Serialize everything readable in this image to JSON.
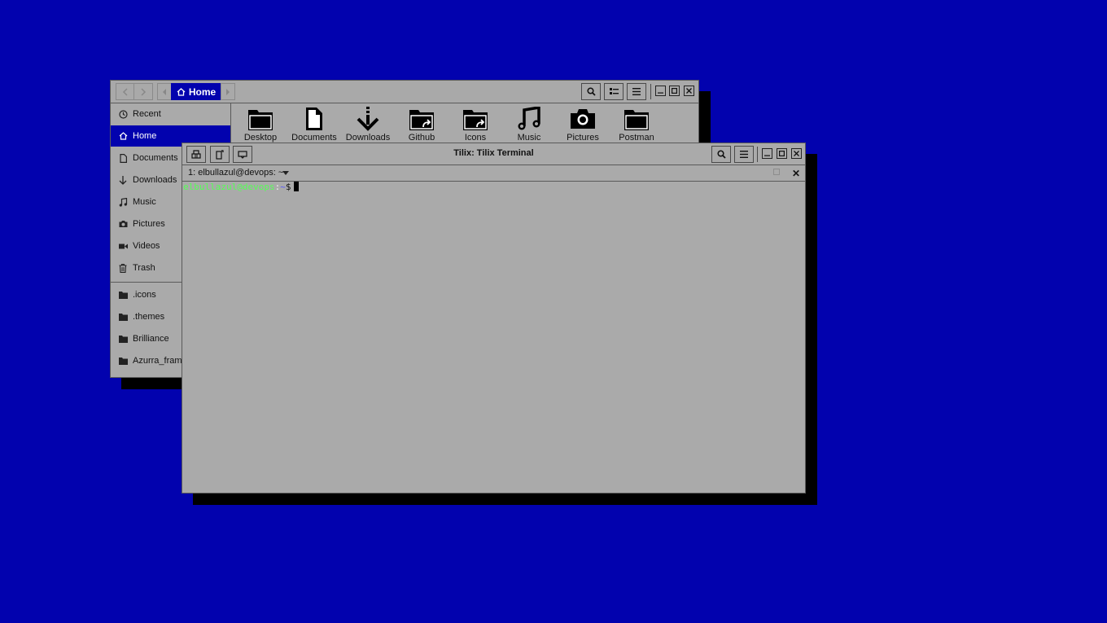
{
  "file_manager": {
    "breadcrumb": {
      "current": "Home"
    },
    "sidebar": {
      "places": [
        {
          "label": "Recent",
          "icon": "clock-icon"
        },
        {
          "label": "Home",
          "icon": "home-icon",
          "active": true
        },
        {
          "label": "Documents",
          "icon": "document-icon"
        },
        {
          "label": "Downloads",
          "icon": "download-icon"
        },
        {
          "label": "Music",
          "icon": "music-icon"
        },
        {
          "label": "Pictures",
          "icon": "camera-icon"
        },
        {
          "label": "Videos",
          "icon": "video-icon"
        },
        {
          "label": "Trash",
          "icon": "trash-icon"
        }
      ],
      "bookmarks": [
        {
          "label": ".icons",
          "icon": "folder-icon"
        },
        {
          "label": ".themes",
          "icon": "folder-icon"
        },
        {
          "label": "Brilliance",
          "icon": "folder-icon"
        },
        {
          "label": "Azurra_fram",
          "icon": "folder-icon"
        }
      ]
    },
    "files": [
      {
        "label": "Desktop",
        "icon": "folder-icon"
      },
      {
        "label": "Documents",
        "icon": "document-icon"
      },
      {
        "label": "Downloads",
        "icon": "download-icon"
      },
      {
        "label": "Github",
        "icon": "folder-link-icon"
      },
      {
        "label": "Icons",
        "icon": "folder-link-icon"
      },
      {
        "label": "Music",
        "icon": "music-icon"
      },
      {
        "label": "Pictures",
        "icon": "camera-icon"
      },
      {
        "label": "Postman",
        "icon": "folder-icon"
      }
    ]
  },
  "terminal": {
    "title": "Tilix: Tilix Terminal",
    "session": {
      "title": "1: elbullazul@devops: ~"
    },
    "prompt": {
      "user": "elbullazul@devops",
      "colon": ":",
      "path": "~",
      "symbol": "$"
    }
  },
  "colors": {
    "desktop": "#0202ae",
    "window": "#aaaaaa",
    "accent": "#0202ae",
    "prompt_user": "#55ff55",
    "prompt_path": "#5555ff"
  }
}
